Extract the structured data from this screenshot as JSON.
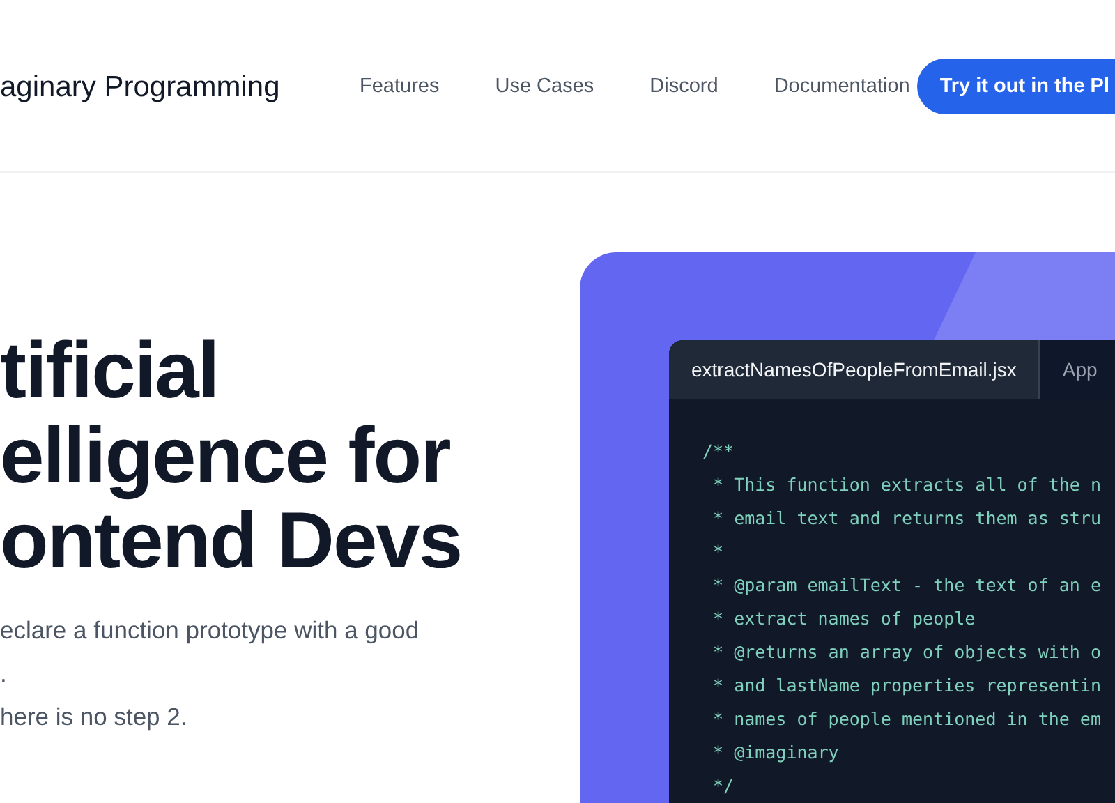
{
  "nav": {
    "logo": "aginary Programming",
    "links": [
      "Features",
      "Use Cases",
      "Discord",
      "Documentation"
    ],
    "cta": "Try it out in the Pl"
  },
  "hero": {
    "heading_lines": [
      "tificial",
      "elligence for",
      "ontend Devs"
    ],
    "paragraphs": [
      [
        "eclare a function prototype with a good",
        "."
      ],
      [
        "here is no step 2."
      ]
    ]
  },
  "editor": {
    "tabs": [
      {
        "label": "extractNamesOfPeopleFromEmail.jsx",
        "selected": true
      },
      {
        "label": "App",
        "selected": false
      }
    ],
    "code_lines": [
      "/**",
      " * This function extracts all of the n",
      " * email text and returns them as stru",
      " *",
      " * @param emailText - the text of an e",
      " * extract names of people",
      " * @returns an array of objects with o",
      " * and lastName properties representin",
      " * names of people mentioned in the em",
      " * @imaginary",
      " */"
    ]
  }
}
